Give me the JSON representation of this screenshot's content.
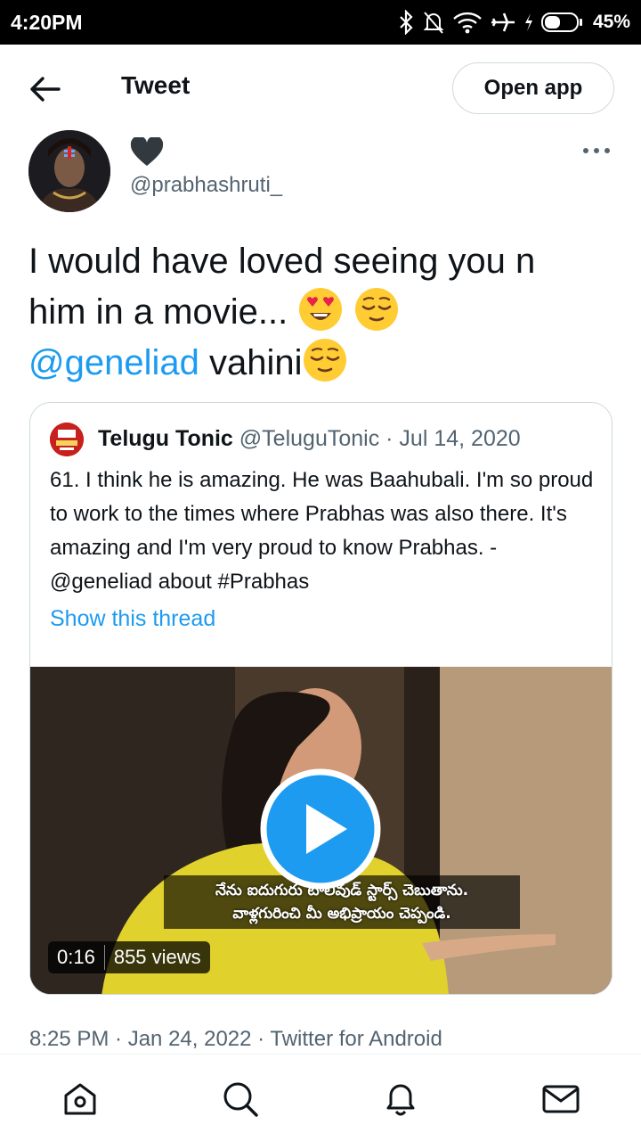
{
  "status_bar": {
    "time": "4:20PM",
    "battery": "45%",
    "icons": [
      "bluetooth-icon",
      "alarm-off-icon",
      "wifi-icon",
      "airplane-icon",
      "charging-icon",
      "battery-icon"
    ]
  },
  "header": {
    "title": "Tweet",
    "open_app_label": "Open app"
  },
  "author": {
    "handle": "@prabhashruti_",
    "display_icon": "heart-icon"
  },
  "tweet": {
    "line1": "I would have loved seeing you n",
    "line2": "him in a movie...",
    "mention": "@geneliad",
    "after_mention": " vahini",
    "emojis": [
      "heart-eyes-emoji",
      "relieved-emoji",
      "relieved-emoji"
    ],
    "timestamp": "8:25 PM · Jan 24, 2022 · Twitter for Android"
  },
  "quoted": {
    "name": "Telugu Tonic",
    "handle": "@TeluguTonic",
    "date": " · Jul 14, 2020",
    "body": "61. I think he is amazing. He was Baahubali. I'm so proud to work to the times where Prabhas was also there. It's amazing and I'm very proud to know Prabhas. - @geneliad about #Prabhas",
    "show_thread": "Show this thread",
    "video": {
      "subtitle_line1": "నేను ఐదుగురు టాలీవుడ్ స్టార్స్ చెబుతాను.",
      "subtitle_line2": "వాళ్లగురించి మీ అభిప్రాయం చెప్పండి.",
      "duration": "0:16",
      "views": "855 views"
    }
  },
  "nav": {
    "items": [
      "home-icon",
      "search-icon",
      "notifications-icon",
      "messages-icon"
    ]
  },
  "colors": {
    "accent": "#1d9bf0",
    "secondary_text": "#536471",
    "border": "#cfd9de"
  }
}
